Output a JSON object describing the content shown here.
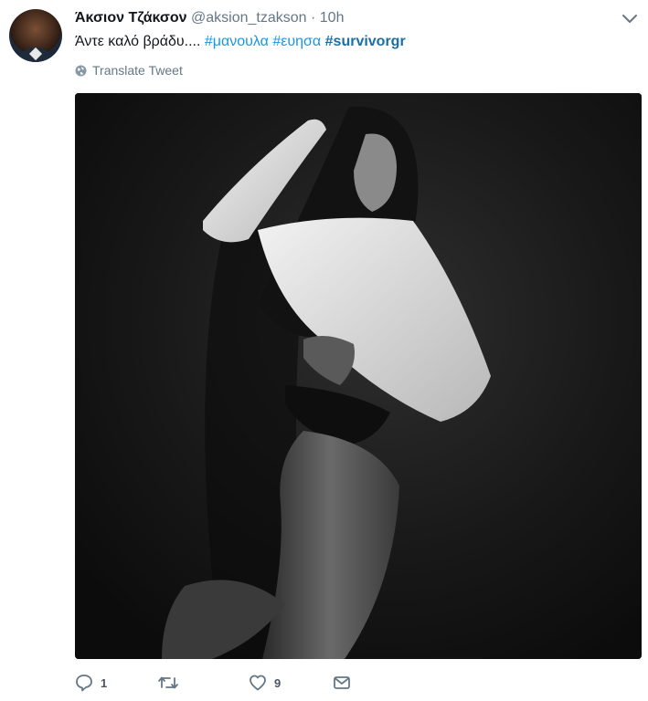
{
  "tweet": {
    "author_name": "Άκσιον Τζάκσον",
    "handle": "@aksion_tzakson",
    "separator": "·",
    "time": "10h",
    "text": "Άντε καλό βράδυ....",
    "hashtags": [
      "#μανουλα",
      "#ευησα",
      "#survivorgr"
    ],
    "translate_label": "Translate Tweet"
  },
  "actions": {
    "reply_count": "1",
    "retweet_count": "",
    "like_count": "9"
  },
  "colors": {
    "link": "#1b95e0",
    "muted": "#657786"
  }
}
